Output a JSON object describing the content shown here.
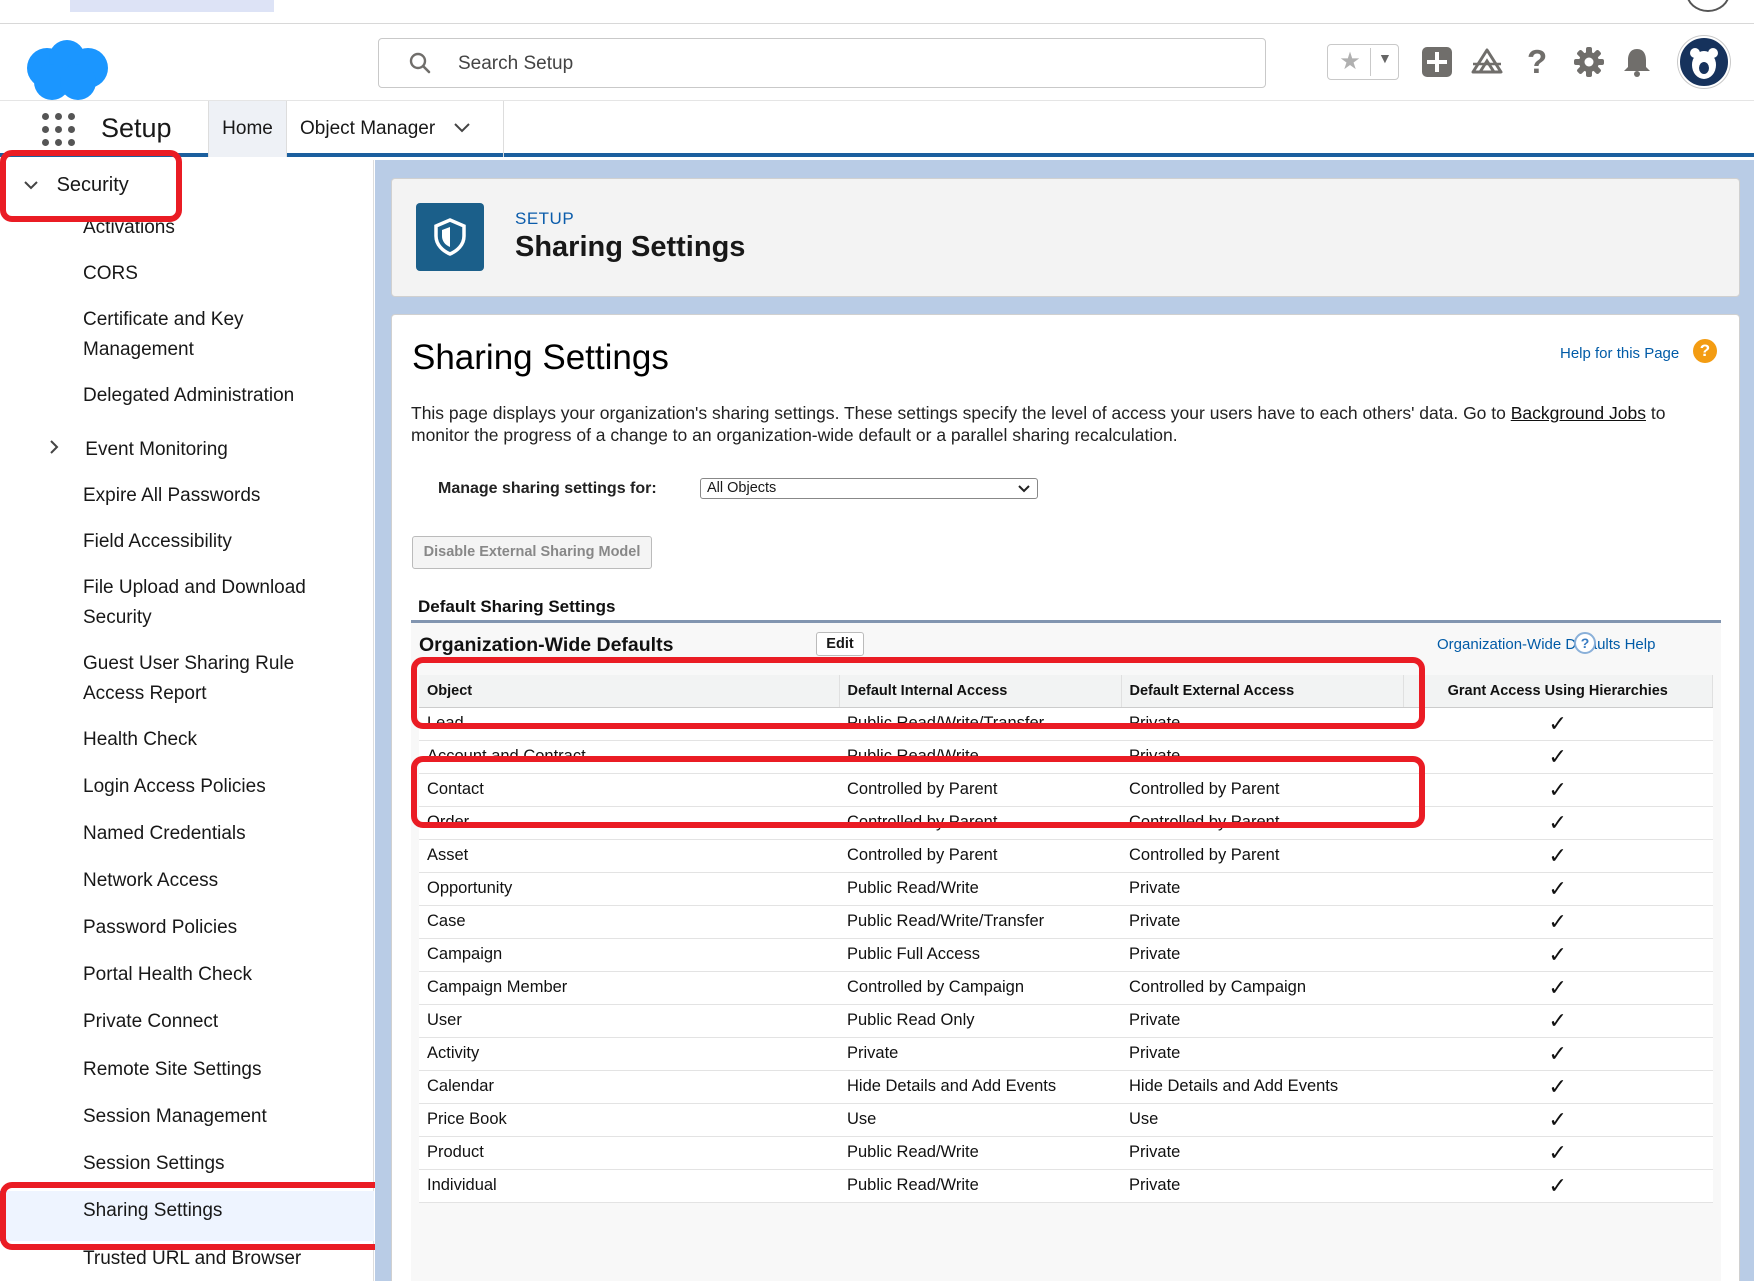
{
  "header": {
    "search_placeholder": "Search Setup"
  },
  "nav": {
    "app_name": "Setup",
    "tabs": [
      {
        "label": "Home"
      },
      {
        "label": "Object Manager"
      }
    ]
  },
  "sidebar": {
    "section": "Security",
    "items": [
      "Activations",
      "CORS",
      "Certificate and Key Management",
      "Delegated Administration",
      "Event Monitoring",
      "Expire All Passwords",
      "Field Accessibility",
      "File Upload and Download Security",
      "Guest User Sharing Rule Access Report",
      "Health Check",
      "Login Access Policies",
      "Named Credentials",
      "Network Access",
      "Password Policies",
      "Portal Health Check",
      "Private Connect",
      "Remote Site Settings",
      "Session Management",
      "Session Settings",
      "Sharing Settings",
      "Trusted URL and Browser"
    ],
    "active_item": "Sharing Settings"
  },
  "page_header": {
    "eyebrow": "SETUP",
    "title": "Sharing Settings"
  },
  "content": {
    "title": "Sharing Settings",
    "help_link": "Help for this Page",
    "description_pre": "This page displays your organization's sharing settings. These settings specify the level of access your users have to each others' data. Go to ",
    "description_link": "Background Jobs",
    "description_post": " to monitor the progress of a change to an organization-wide default or a parallel sharing recalculation.",
    "manage_label": "Manage sharing settings for:",
    "manage_value": "All Objects",
    "disable_button": "Disable External Sharing Model",
    "section_label": "Default Sharing Settings"
  },
  "owd": {
    "title": "Organization-Wide Defaults",
    "edit_label": "Edit",
    "help_label": "Organization-Wide Defaults Help",
    "columns": [
      "Object",
      "Default Internal Access",
      "Default External Access",
      "Grant Access Using Hierarchies"
    ],
    "rows": [
      {
        "object": "Lead",
        "internal": "Public Read/Write/Transfer",
        "external": "Private",
        "grant": true
      },
      {
        "object": "Account and Contract",
        "internal": "Public Read/Write",
        "external": "Private",
        "grant": true
      },
      {
        "object": "Contact",
        "internal": "Controlled by Parent",
        "external": "Controlled by Parent",
        "grant": true
      },
      {
        "object": "Order",
        "internal": "Controlled by Parent",
        "external": "Controlled by Parent",
        "grant": true
      },
      {
        "object": "Asset",
        "internal": "Controlled by Parent",
        "external": "Controlled by Parent",
        "grant": true
      },
      {
        "object": "Opportunity",
        "internal": "Public Read/Write",
        "external": "Private",
        "grant": true
      },
      {
        "object": "Case",
        "internal": "Public Read/Write/Transfer",
        "external": "Private",
        "grant": true
      },
      {
        "object": "Campaign",
        "internal": "Public Full Access",
        "external": "Private",
        "grant": true
      },
      {
        "object": "Campaign Member",
        "internal": "Controlled by Campaign",
        "external": "Controlled by Campaign",
        "grant": true
      },
      {
        "object": "User",
        "internal": "Public Read Only",
        "external": "Private",
        "grant": true
      },
      {
        "object": "Activity",
        "internal": "Private",
        "external": "Private",
        "grant": true
      },
      {
        "object": "Calendar",
        "internal": "Hide Details and Add Events",
        "external": "Hide Details and Add Events",
        "grant": true
      },
      {
        "object": "Price Book",
        "internal": "Use",
        "external": "Use",
        "grant": true
      },
      {
        "object": "Product",
        "internal": "Public Read/Write",
        "external": "Private",
        "grant": true
      },
      {
        "object": "Individual",
        "internal": "Public Read/Write",
        "external": "Private",
        "grant": true
      }
    ]
  },
  "colors": {
    "accent": "#0b5cab",
    "highlight": "#ea1c24",
    "brand": "#1b96ff"
  }
}
